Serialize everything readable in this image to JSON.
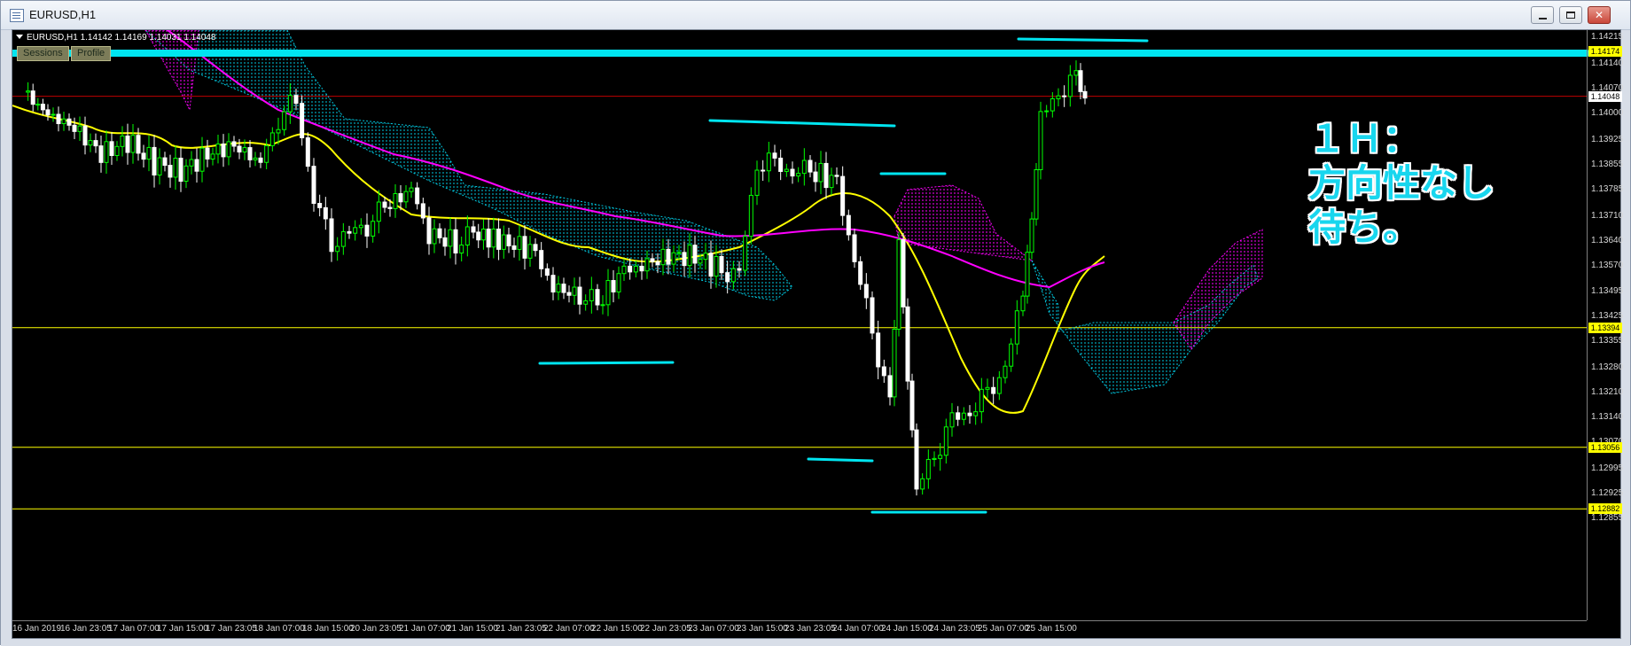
{
  "window": {
    "title": "EURUSD,H1",
    "minimize_label": "",
    "maximize_label": "",
    "close_label": "✕"
  },
  "chart": {
    "symbol_info": "EURUSD,H1  1.14142 1.14169 1.14031 1.14048",
    "tabs": [
      "Sessions",
      "Profile"
    ],
    "price_axis": [
      "1.14215",
      "1.14140",
      "1.14070",
      "1.14000",
      "1.13925",
      "1.13855",
      "1.13785",
      "1.13710",
      "1.13640",
      "1.13570",
      "1.13495",
      "1.13425",
      "1.13355",
      "1.13280",
      "1.13210",
      "1.13140",
      "1.13070",
      "1.12995",
      "1.12925",
      "1.12855"
    ],
    "price_tags": [
      {
        "value": "1.14174",
        "bg": "#ffff00"
      },
      {
        "value": "1.14048",
        "bg": "#ffffff"
      },
      {
        "value": "1.13394",
        "bg": "#ffff00"
      },
      {
        "value": "1.13056",
        "bg": "#ffff00"
      },
      {
        "value": "1.12882",
        "bg": "#ffff00"
      }
    ],
    "time_axis": [
      "16 Jan 2019",
      "16 Jan 23:05",
      "17 Jan 07:00",
      "17 Jan 15:00",
      "17 Jan 23:05",
      "18 Jan 07:00",
      "18 Jan 15:00",
      "20 Jan 23:05",
      "21 Jan 07:00",
      "21 Jan 15:00",
      "21 Jan 23:05",
      "22 Jan 07:00",
      "22 Jan 15:00",
      "22 Jan 23:05",
      "23 Jan 07:00",
      "23 Jan 15:00",
      "23 Jan 23:05",
      "24 Jan 07:00",
      "24 Jan 15:00",
      "24 Jan 23:05",
      "25 Jan 07:00",
      "25 Jan 15:00"
    ],
    "annotation_lines": [
      "１Ｈ：",
      "方向性なし",
      "待ち。"
    ],
    "colors": {
      "background": "#000000",
      "bull_candle": "#00ff00",
      "bear_candle": "#ffffff",
      "fast_ma": "#ffff00",
      "slow_ma": "#ff00ff",
      "drawn_lines": "#00e5f0",
      "cloud_up": "#00c8e0",
      "cloud_down": "#ff00ff",
      "bid_line": "#c00000"
    }
  }
}
